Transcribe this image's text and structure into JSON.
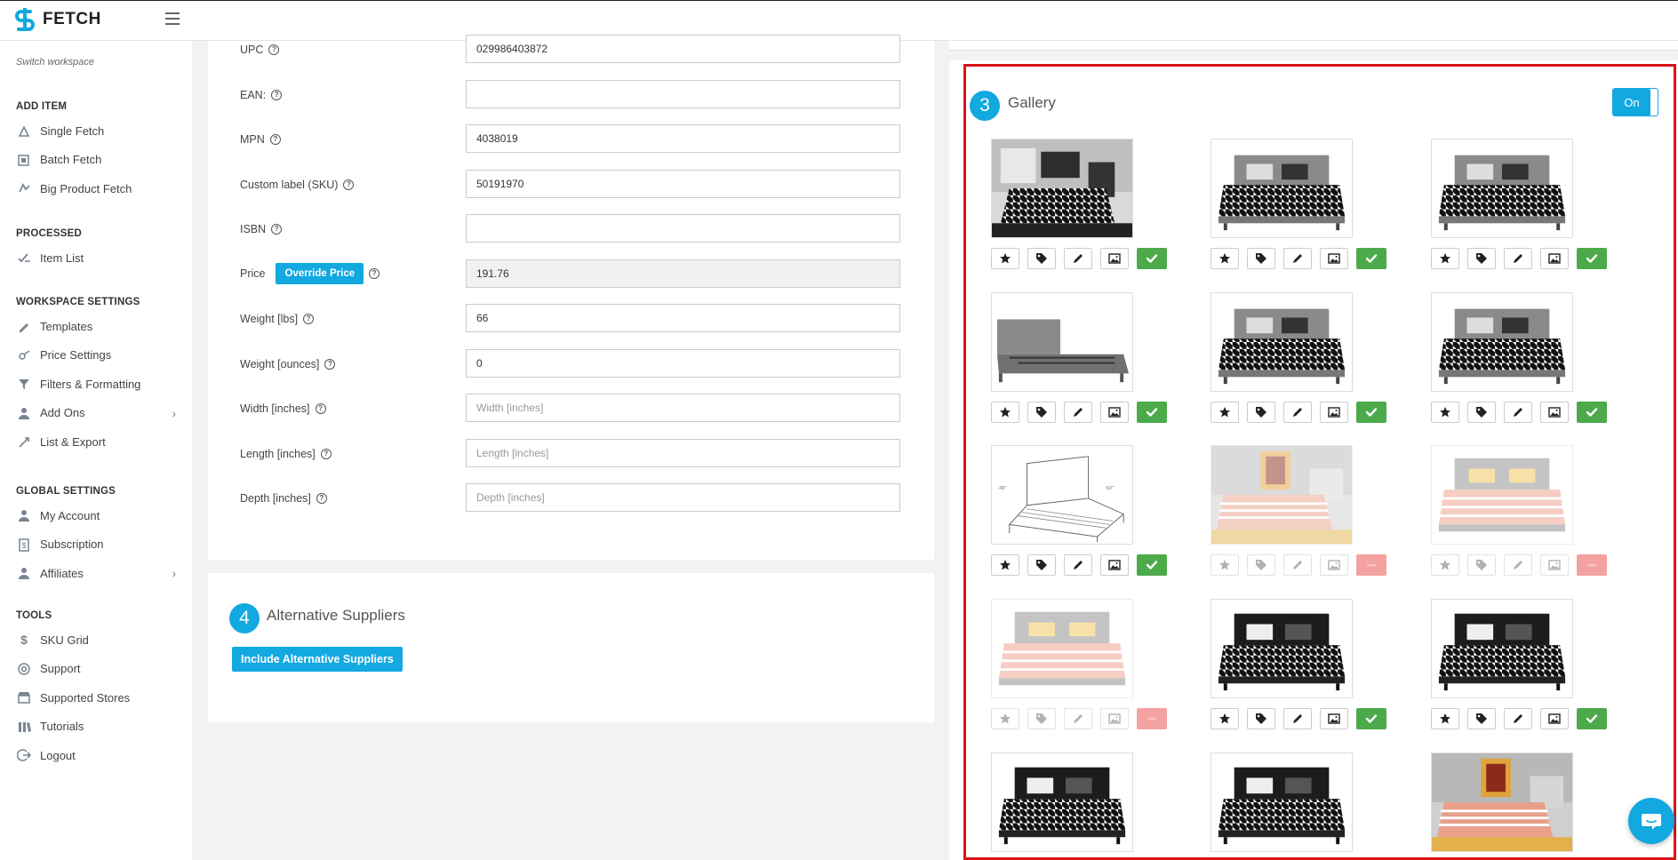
{
  "app": {
    "name": "FETCH"
  },
  "sidebar": {
    "switch_workspace": "Switch workspace",
    "sections": [
      {
        "title": "ADD ITEM",
        "items": [
          {
            "label": "Single Fetch",
            "icon": "single-fetch-icon"
          },
          {
            "label": "Batch Fetch",
            "icon": "batch-fetch-icon"
          },
          {
            "label": "Big Product Fetch",
            "icon": "big-product-fetch-icon"
          }
        ]
      },
      {
        "title": "PROCESSED",
        "items": [
          {
            "label": "Item List",
            "icon": "item-list-icon"
          }
        ]
      },
      {
        "title": "WORKSPACE SETTINGS",
        "items": [
          {
            "label": "Templates",
            "icon": "templates-icon"
          },
          {
            "label": "Price Settings",
            "icon": "price-settings-icon"
          },
          {
            "label": "Filters & Formatting",
            "icon": "filter-icon"
          },
          {
            "label": "Add Ons",
            "icon": "add-ons-icon",
            "chevron": "›"
          },
          {
            "label": "List & Export",
            "icon": "list-export-icon"
          }
        ]
      },
      {
        "title": "GLOBAL SETTINGS",
        "items": [
          {
            "label": "My Account",
            "icon": "user-icon"
          },
          {
            "label": "Subscription",
            "icon": "subscription-icon"
          },
          {
            "label": "Affiliates",
            "icon": "affiliates-icon",
            "chevron": "›"
          }
        ]
      },
      {
        "title": "TOOLS",
        "items": [
          {
            "label": "SKU Grid",
            "icon": "sku-grid-icon"
          },
          {
            "label": "Support",
            "icon": "support-icon"
          },
          {
            "label": "Supported Stores",
            "icon": "stores-icon"
          },
          {
            "label": "Tutorials",
            "icon": "tutorials-icon"
          },
          {
            "label": "Logout",
            "icon": "logout-icon"
          }
        ]
      }
    ]
  },
  "form": {
    "fields": [
      {
        "key": "upc",
        "label": "UPC",
        "value": "029986403872",
        "placeholder": ""
      },
      {
        "key": "ean",
        "label": "EAN:",
        "value": "",
        "placeholder": ""
      },
      {
        "key": "mpn",
        "label": "MPN",
        "value": "4038019",
        "placeholder": ""
      },
      {
        "key": "sku",
        "label": "Custom label (SKU)",
        "value": "50191970",
        "placeholder": ""
      },
      {
        "key": "isbn",
        "label": "ISBN",
        "value": "",
        "placeholder": ""
      },
      {
        "key": "price",
        "label": "Price",
        "value": "191.76",
        "placeholder": "",
        "button": "Override Price",
        "readonly": true
      },
      {
        "key": "weight_lbs",
        "label": "Weight [lbs]",
        "value": "66",
        "placeholder": ""
      },
      {
        "key": "weight_oz",
        "label": "Weight [ounces]",
        "value": "0",
        "placeholder": ""
      },
      {
        "key": "width",
        "label": "Width [inches]",
        "value": "",
        "placeholder": "Width [inches]"
      },
      {
        "key": "length",
        "label": "Length [inches]",
        "value": "",
        "placeholder": "Length [inches]"
      },
      {
        "key": "depth",
        "label": "Depth [inches]",
        "value": "",
        "placeholder": "Depth [inches]"
      }
    ],
    "help_glyph": "?"
  },
  "alternative_suppliers": {
    "number": "4",
    "title": "Alternative Suppliers",
    "button": "Include Alternative Suppliers"
  },
  "gallery": {
    "number": "3",
    "title": "Gallery",
    "toggle_label": "On",
    "colors": {
      "accent": "#12a8e0",
      "enabled": "#4caa4a",
      "disabled": "#f4a1a1",
      "frame": "#d9141b"
    },
    "images": [
      {
        "scene": "bedroom-houndstooth",
        "enabled": true
      },
      {
        "scene": "gray-bed-houndstooth",
        "enabled": true
      },
      {
        "scene": "gray-bed-houndstooth",
        "enabled": true
      },
      {
        "scene": "bare-frame",
        "enabled": true
      },
      {
        "scene": "gray-bed-houndstooth",
        "enabled": true
      },
      {
        "scene": "gray-bed-houndstooth",
        "enabled": true
      },
      {
        "scene": "line-drawing",
        "enabled": true
      },
      {
        "scene": "bedroom-pink",
        "enabled": false
      },
      {
        "scene": "gray-bed-pink",
        "enabled": false
      },
      {
        "scene": "gray-bed-pink",
        "enabled": false
      },
      {
        "scene": "black-bed-houndstooth",
        "enabled": true
      },
      {
        "scene": "black-bed-houndstooth",
        "enabled": true
      },
      {
        "scene": "black-bed-houndstooth",
        "enabled": true
      },
      {
        "scene": "black-bed-houndstooth",
        "enabled": true
      },
      {
        "scene": "bedroom-pink",
        "enabled": true
      }
    ]
  }
}
